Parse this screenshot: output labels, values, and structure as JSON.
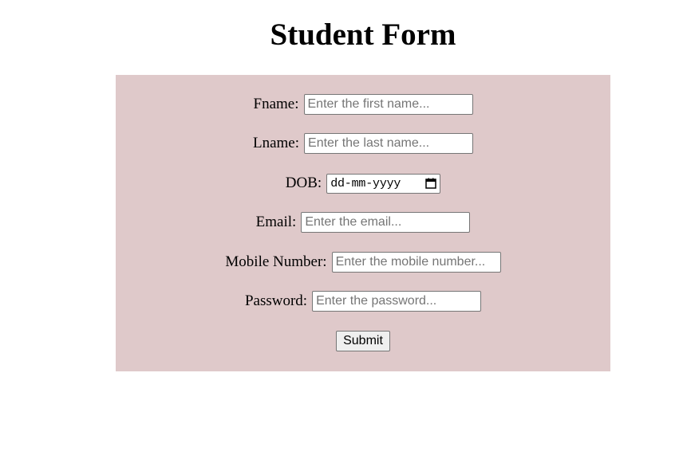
{
  "page": {
    "title": "Student Form"
  },
  "form": {
    "fname": {
      "label": "Fname:",
      "placeholder": "Enter the first name..."
    },
    "lname": {
      "label": "Lname:",
      "placeholder": "Enter the last name..."
    },
    "dob": {
      "label": "DOB:",
      "value_display": "dd-mm-yyyy"
    },
    "email": {
      "label": "Email:",
      "placeholder": "Enter the email..."
    },
    "mobile": {
      "label": "Mobile Number:",
      "placeholder": "Enter the mobile number..."
    },
    "password": {
      "label": "Password:",
      "placeholder": "Enter the password..."
    },
    "submit_label": "Submit"
  },
  "colors": {
    "panel_background": "#dfc9ca",
    "page_background": "#ffffff"
  },
  "icons": {
    "dob_picker": "calendar-icon"
  }
}
